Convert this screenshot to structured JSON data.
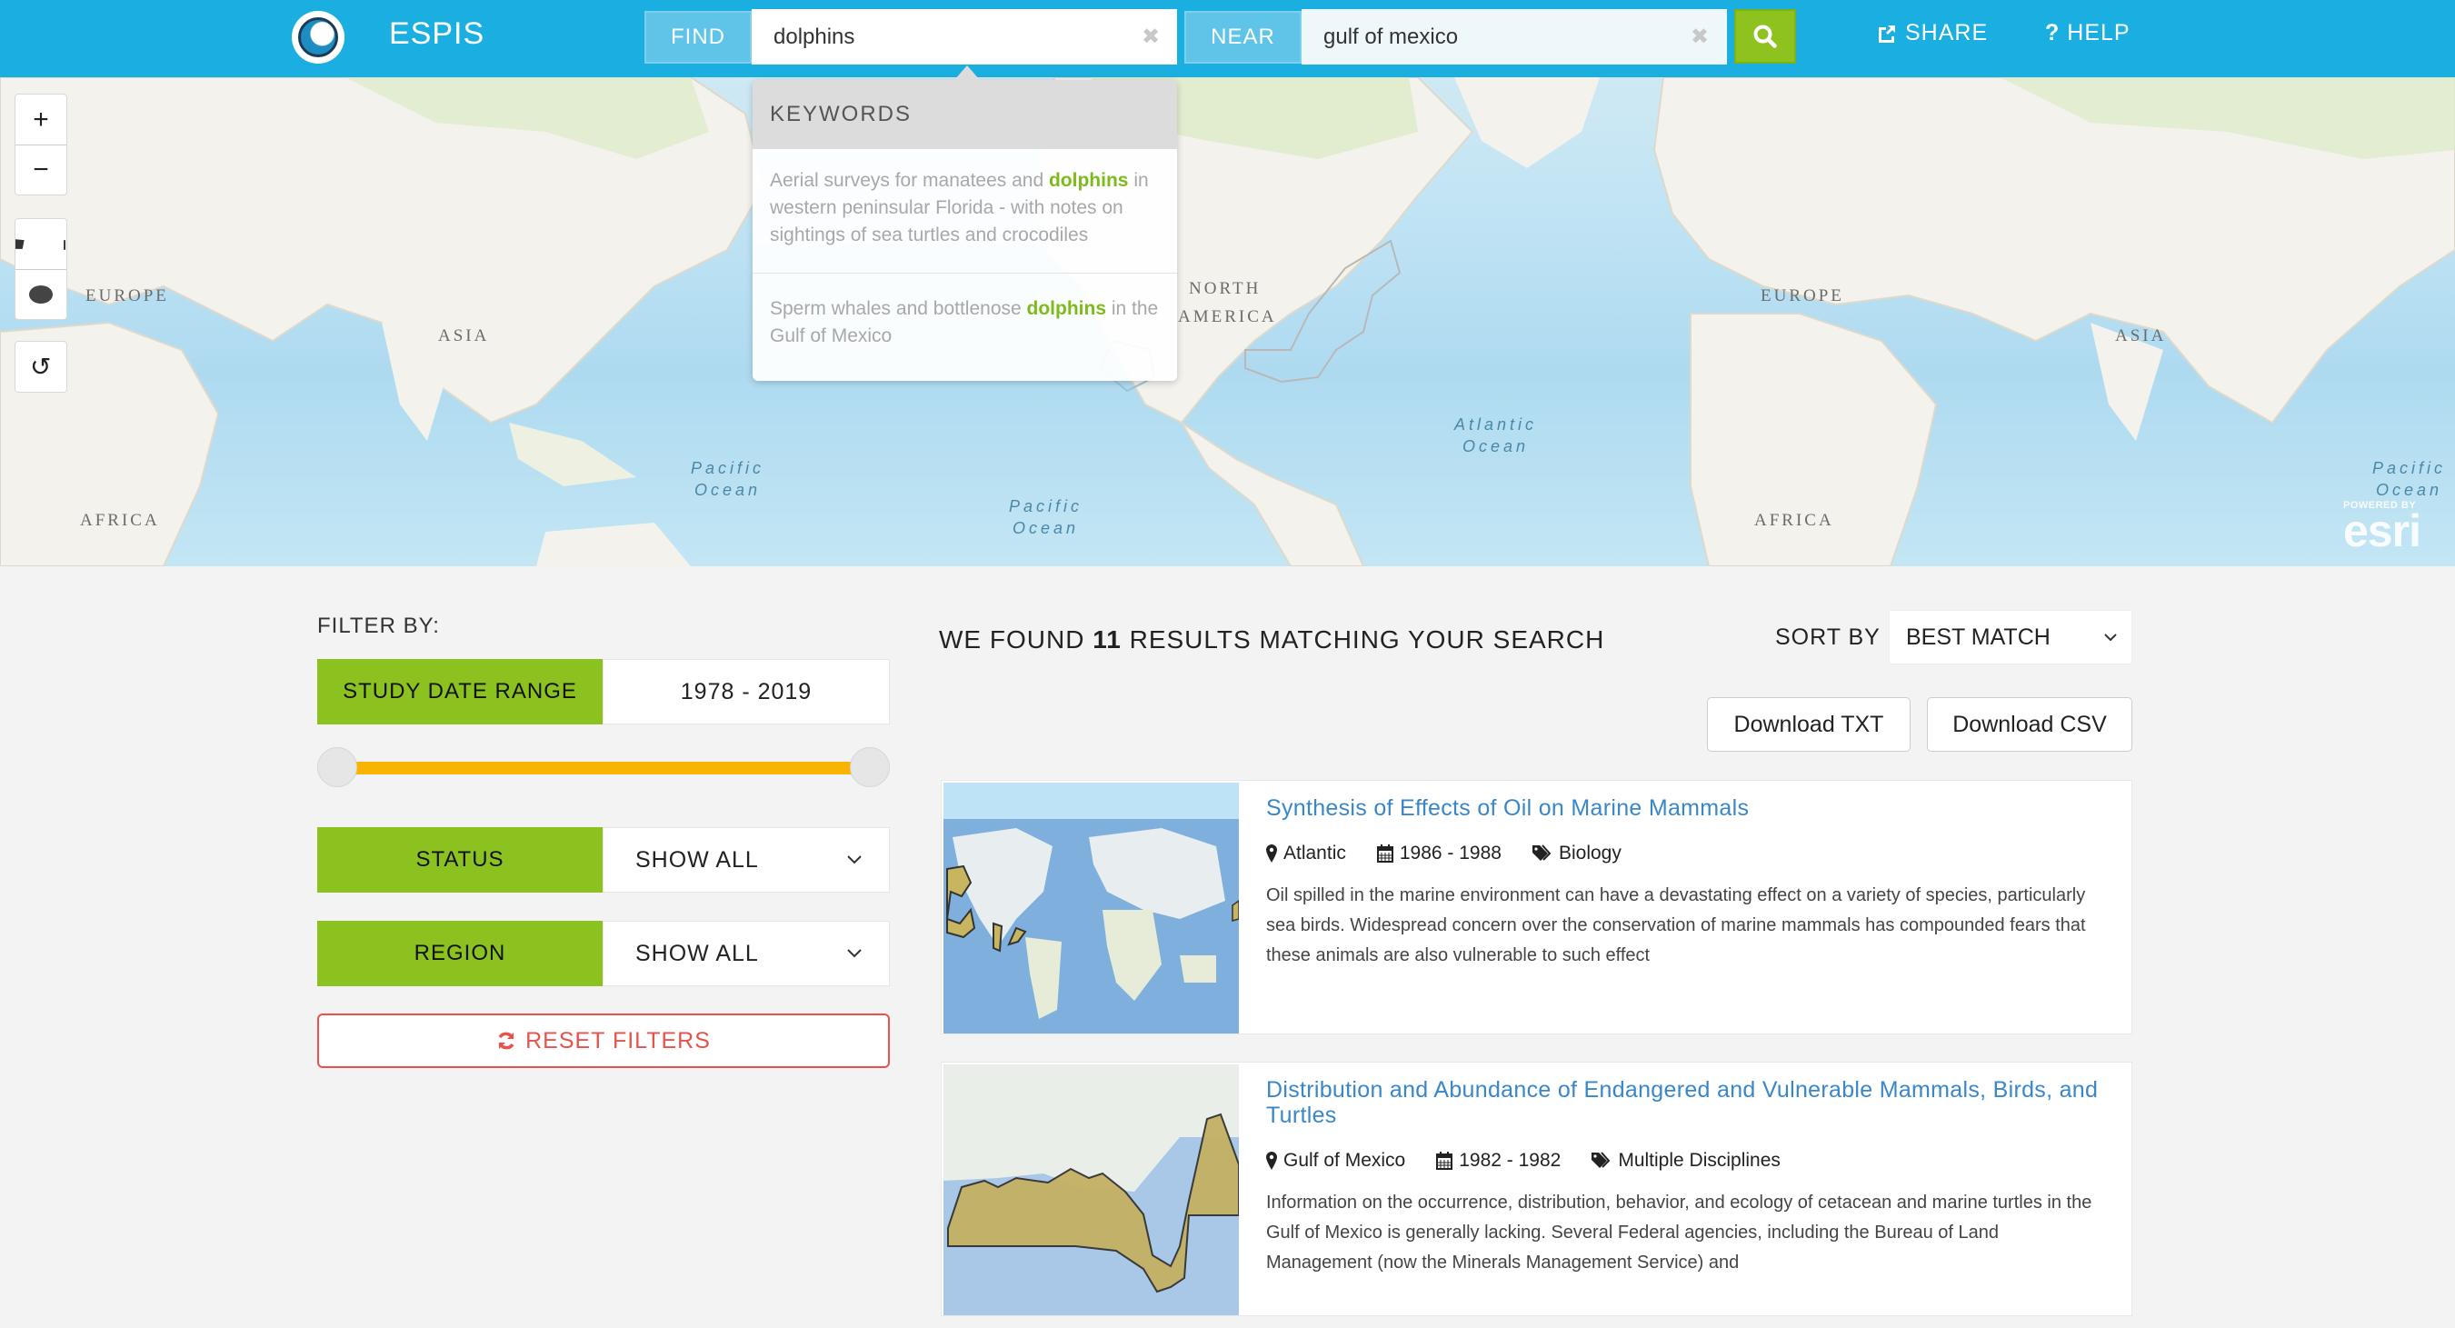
{
  "header": {
    "brand": "ESPIS",
    "find_label": "FIND",
    "find_value": "dolphins",
    "near_label": "NEAR",
    "near_value": "gulf of mexico",
    "clear_glyph": "✖",
    "share_label": "SHARE",
    "help_label": "HELP",
    "help_glyph": "?",
    "colors": {
      "bar": "#1aafe0",
      "search_button": "#8dc21f"
    }
  },
  "map": {
    "controls": {
      "zoom_in": "+",
      "zoom_out": "−",
      "reset_glyph": "↻"
    },
    "labels": {
      "europe": "EUROPE",
      "asia": "ASIA",
      "africa": "AFRICA",
      "north_america_1": "NORTH",
      "north_america_2": "AMERICA",
      "atlantic_1": "Atlantic",
      "atlantic_2": "Ocean",
      "pacific_1": "Pacific",
      "pacific_2": "Ocean"
    },
    "attribution": {
      "powered_by": "POWERED BY",
      "name": "esri"
    }
  },
  "keywords_dropdown": {
    "heading": "KEYWORDS",
    "items": [
      {
        "before": "Aerial surveys for manatees and ",
        "match": "dolphins",
        "after": " in western peninsular Florida - with notes on sightings of sea turtles and crocodiles"
      },
      {
        "before": "Sperm whales and bottlenose ",
        "match": "dolphins",
        "after": " in the Gulf of Mexico"
      }
    ]
  },
  "filters": {
    "title": "FILTER BY:",
    "date_range": {
      "label": "STUDY DATE RANGE",
      "value": "1978 - 2019",
      "min": 1978,
      "max": 2019,
      "selected_min": 1978,
      "selected_max": 2019
    },
    "status": {
      "label": "STATUS",
      "value": "SHOW ALL"
    },
    "region": {
      "label": "REGION",
      "value": "SHOW ALL"
    },
    "reset_label": "RESET FILTERS",
    "colors": {
      "label_bg": "#8bc21f",
      "slider_track": "#f8b400",
      "reset": "#e8524b"
    }
  },
  "results": {
    "title_prefix": "WE FOUND",
    "count": "11",
    "title_suffix": "RESULTS MATCHING YOUR SEARCH",
    "sort_label": "SORT BY",
    "sort_value": "BEST MATCH",
    "download_txt": "Download TXT",
    "download_csv": "Download CSV",
    "items": [
      {
        "title": "Synthesis of Effects of Oil on Marine Mammals",
        "region": "Atlantic",
        "dates": "1986 - 1988",
        "discipline": "Biology",
        "description": "Oil spilled in the marine environment can have a devastating effect on a variety of species, particularly sea birds. Widespread concern over the conservation of marine mammals has compounded fears that these animals are also vulnerable to such effect"
      },
      {
        "title": "Distribution and Abundance of Endangered and Vulnerable Mammals, Birds, and Turtles",
        "region": "Gulf of Mexico",
        "dates": "1982 - 1982",
        "discipline": "Multiple Disciplines",
        "description": "Information on the occurrence, distribution, behavior, and ecology of cetacean and marine turtles in the Gulf of Mexico is generally lacking. Several Federal agencies, including the Bureau of Land Management (now the Minerals Management Service) and"
      }
    ]
  }
}
